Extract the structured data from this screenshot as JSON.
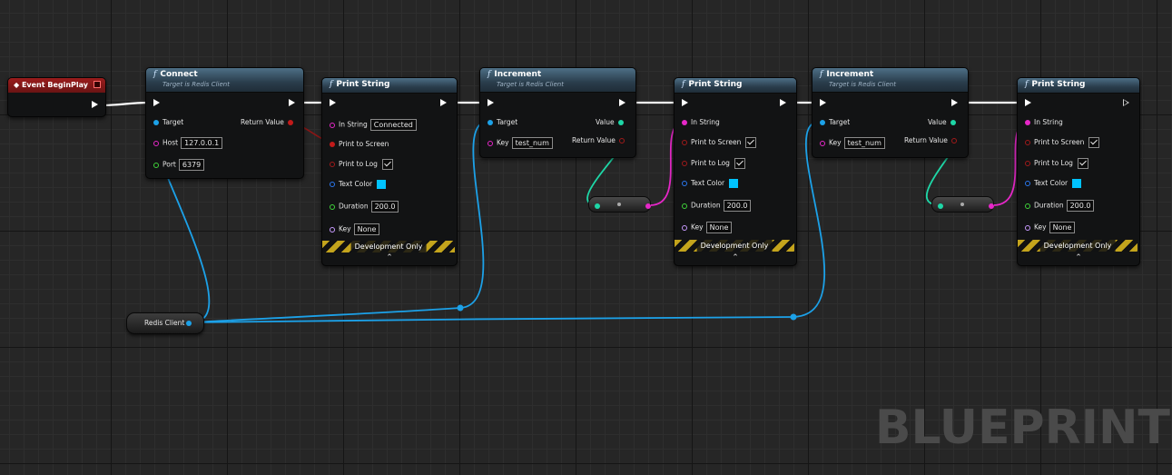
{
  "watermark": "BLUEPRINT",
  "event_node": {
    "title": "Event BeginPlay"
  },
  "connect_node": {
    "title": "Connect",
    "subtitle": "Target is Redis Client",
    "target_label": "Target",
    "return_label": "Return Value",
    "host_label": "Host",
    "host_value": "127.0.0.1",
    "port_label": "Port",
    "port_value": "6379"
  },
  "print_nodes": [
    {
      "title": "Print String",
      "in_string_label": "In String",
      "in_string_value": "Connected",
      "print_screen_label": "Print to Screen",
      "print_log_label": "Print to Log",
      "text_color_label": "Text Color",
      "duration_label": "Duration",
      "duration_value": "200.0",
      "key_label": "Key",
      "key_value": "None",
      "dev_label": "Development Only"
    },
    {
      "title": "Print String",
      "in_string_label": "In String",
      "print_screen_label": "Print to Screen",
      "print_log_label": "Print to Log",
      "text_color_label": "Text Color",
      "duration_label": "Duration",
      "duration_value": "200.0",
      "key_label": "Key",
      "key_value": "None",
      "dev_label": "Development Only"
    },
    {
      "title": "Print String",
      "in_string_label": "In String",
      "print_screen_label": "Print to Screen",
      "print_log_label": "Print to Log",
      "text_color_label": "Text Color",
      "duration_label": "Duration",
      "duration_value": "200.0",
      "key_label": "Key",
      "key_value": "None",
      "dev_label": "Development Only"
    }
  ],
  "increment_nodes": [
    {
      "title": "Increment",
      "subtitle": "Target is Redis Client",
      "target_label": "Target",
      "value_label": "Value",
      "key_label": "Key",
      "key_value": "test_num",
      "return_label": "Return Value"
    },
    {
      "title": "Increment",
      "subtitle": "Target is Redis Client",
      "target_label": "Target",
      "value_label": "Value",
      "key_label": "Key",
      "key_value": "test_num",
      "return_label": "Return Value"
    }
  ],
  "variable_node": {
    "label": "Redis Client"
  },
  "colors": {
    "exec": "#ffffff",
    "object_pin": "#1ca1e8",
    "string_pin": "#e627c8",
    "int_pin": "#1ed7a7",
    "bool_pin": "#a11a1a",
    "event_header": "#9a1c1c",
    "function_header": "#4d6f86"
  }
}
